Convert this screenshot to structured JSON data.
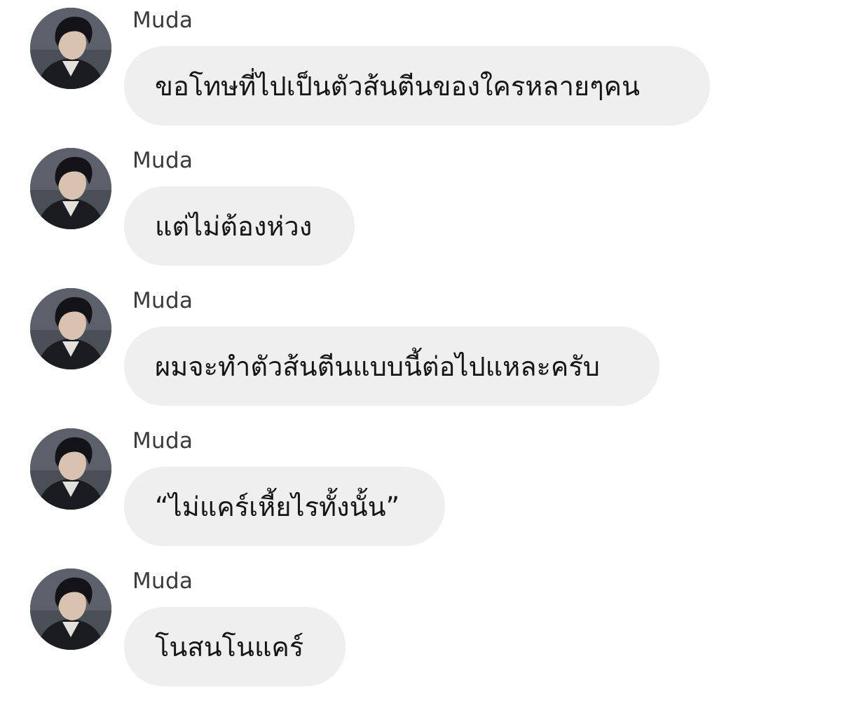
{
  "messages": [
    {
      "sender": "Muda",
      "text": "ขอโทษที่ไปเป็นตัวส้นตีนของใครหลายๆคน",
      "avatar": "profile-photo"
    },
    {
      "sender": "Muda",
      "text": "แต่ไม่ต้องห่วง",
      "avatar": "profile-photo"
    },
    {
      "sender": "Muda",
      "text": "ผมจะทำตัวส้นตีนแบบนี้ต่อไปแหละครับ",
      "avatar": "profile-photo"
    },
    {
      "sender": "Muda",
      "text": "“ไม่แคร์เหี้ยไรทั้งนั้น”",
      "avatar": "profile-photo"
    },
    {
      "sender": "Muda",
      "text": "โนสนโนแคร์",
      "avatar": "profile-photo"
    }
  ],
  "colors": {
    "background": "#ffffff",
    "bubble": "#efefef",
    "message_text": "#161616",
    "sender_text": "#3a3a3a"
  }
}
